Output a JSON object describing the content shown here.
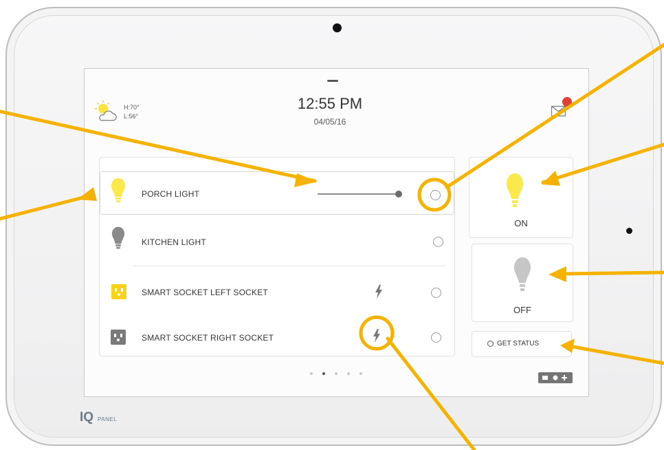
{
  "weather": {
    "high": "H:70°",
    "low": "L:56°",
    "icon": "partly-cloudy-icon"
  },
  "header": {
    "time": "12:55 PM",
    "date": "04/05/16"
  },
  "devices": [
    {
      "label": "PORCH LIGHT",
      "icon": "bulb-on-icon",
      "dimmer_level": 0.85,
      "selected": true
    },
    {
      "label": "KITCHEN LIGHT",
      "icon": "bulb-off-icon"
    },
    {
      "label": "SMART SOCKET LEFT SOCKET",
      "icon": "socket-on-icon",
      "power_icon": "lightning-icon"
    },
    {
      "label": "SMART SOCKET RIGHT SOCKET",
      "icon": "socket-off-icon",
      "power_icon": "lightning-icon"
    }
  ],
  "actions": {
    "on_label": "ON",
    "off_label": "OFF",
    "status_label": "GET STATUS"
  },
  "pager": {
    "pages": 5,
    "current": 2
  },
  "brand": {
    "logo": "IQ",
    "sub": "PANEL"
  },
  "colors": {
    "accent": "#f5b300",
    "bulb_on": "#fbe84a",
    "bulb_off": "#8a8a8a",
    "notification": "#e0403a"
  }
}
